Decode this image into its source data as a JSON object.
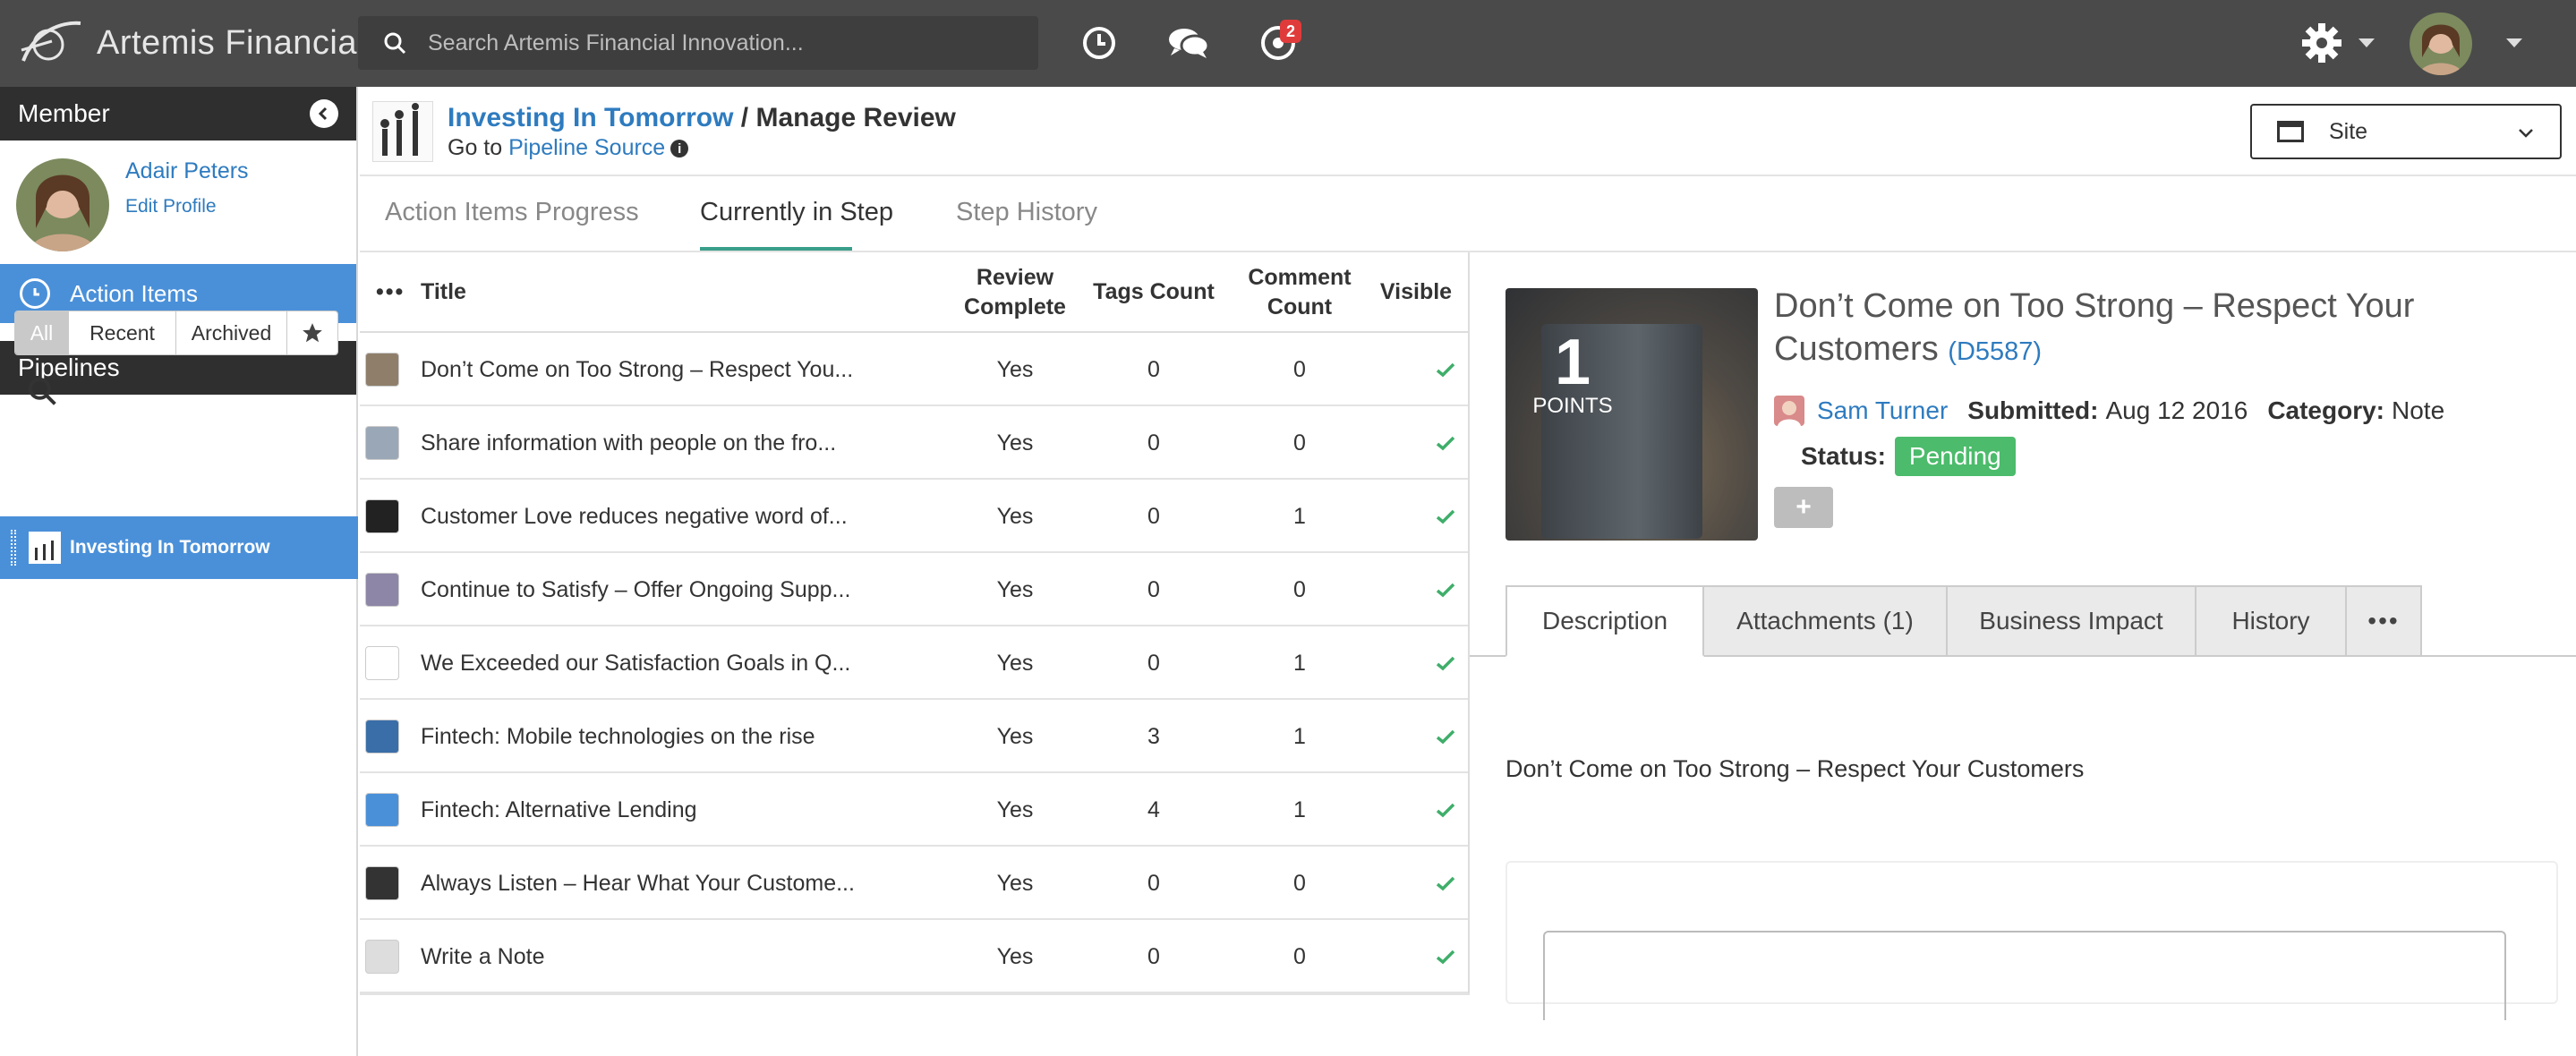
{
  "app": {
    "title": "Artemis Financial",
    "search_placeholder": "Search Artemis Financial Innovation...",
    "notification_count": "2"
  },
  "sidebar": {
    "member_header": "Member",
    "member_name": "Adair Peters",
    "edit_profile": "Edit Profile",
    "action_items": "Action Items",
    "pipelines_header": "Pipelines",
    "filters": [
      "All",
      "Recent",
      "Archived"
    ],
    "active_filter": "All",
    "pipeline_item": "Investing In Tomorrow"
  },
  "header": {
    "breadcrumb_link": "Investing In Tomorrow",
    "breadcrumb_sep": " / ",
    "breadcrumb_current": "Manage Review",
    "goto_prefix": "Go to ",
    "goto_link": "Pipeline Source",
    "site_select": "Site"
  },
  "tabs": [
    "Action Items Progress",
    "Currently in Step",
    "Step History"
  ],
  "active_tab": "Currently in Step",
  "table": {
    "columns": {
      "more": "•••",
      "title": "Title",
      "review_complete_1": "Review",
      "review_complete_2": "Complete",
      "tags_count": "Tags Count",
      "comment_count_1": "Comment",
      "comment_count_2": "Count",
      "visible": "Visible"
    },
    "rows": [
      {
        "title": "Don’t Come on Too Strong – Respect You...",
        "review": "Yes",
        "tags": "0",
        "comments": "0",
        "thumb": "#8f7f6a"
      },
      {
        "title": "Share information with people on the fro...",
        "review": "Yes",
        "tags": "0",
        "comments": "0",
        "thumb": "#9aa7b6"
      },
      {
        "title": "Customer Love reduces negative word of...",
        "review": "Yes",
        "tags": "0",
        "comments": "1",
        "thumb": "#222222"
      },
      {
        "title": "Continue to Satisfy – Offer Ongoing Supp...",
        "review": "Yes",
        "tags": "0",
        "comments": "0",
        "thumb": "#8d86a6"
      },
      {
        "title": "We Exceeded our Satisfaction Goals in Q...",
        "review": "Yes",
        "tags": "0",
        "comments": "1",
        "thumb": "#ffffff"
      },
      {
        "title": "Fintech: Mobile technologies on the rise",
        "review": "Yes",
        "tags": "3",
        "comments": "1",
        "thumb": "#3a6ea8"
      },
      {
        "title": "Fintech: Alternative Lending",
        "review": "Yes",
        "tags": "4",
        "comments": "1",
        "thumb": "#4a90d9"
      },
      {
        "title": "Always Listen – Hear What Your Custome...",
        "review": "Yes",
        "tags": "0",
        "comments": "0",
        "thumb": "#333333"
      },
      {
        "title": "Write a Note",
        "review": "Yes",
        "tags": "0",
        "comments": "0",
        "thumb": "#dddddd"
      }
    ]
  },
  "detail": {
    "points_number": "1",
    "points_label": "POINTS",
    "title": "Don’t Come on Too Strong – Respect Your Customers",
    "code_open": "(",
    "code": "D5587",
    "code_close": ")",
    "author": "Sam Turner",
    "submitted_label": "Submitted:",
    "submitted_value": "Aug 12 2016",
    "category_label": "Category:",
    "category_value": "Note",
    "status_label": "Status:",
    "status_value": "Pending",
    "plus": "+",
    "tabs": [
      "Description",
      "Attachments (1)",
      "Business Impact",
      "History",
      "•••"
    ],
    "description": "Don’t Come on Too Strong – Respect Your Customers"
  },
  "colors": {
    "topbar": "#4a4a4a",
    "accent_blue": "#4a90d9",
    "link": "#2e7bbf",
    "tab_underline": "#3a9e8a",
    "status_green": "#4cbb6b",
    "check_green": "#3fae6a",
    "badge_red": "#e03b3b"
  },
  "icons": [
    "logo-swoosh-icon",
    "search-icon",
    "clock-icon",
    "chat-icon",
    "notification-icon",
    "gear-icon",
    "collapse-icon",
    "star-icon",
    "window-icon",
    "info-icon",
    "check-icon"
  ]
}
